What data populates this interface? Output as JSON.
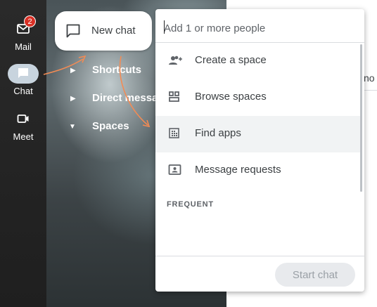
{
  "rail": {
    "items": [
      {
        "label": "Mail",
        "icon": "mail-icon",
        "badge": "2"
      },
      {
        "label": "Chat",
        "icon": "chat-icon"
      },
      {
        "label": "Meet",
        "icon": "video-icon"
      }
    ]
  },
  "nav": {
    "shortcuts": "Shortcuts",
    "direct_messages": "Direct messages",
    "spaces": "Spaces"
  },
  "new_chat": {
    "label": "New chat"
  },
  "dropdown": {
    "search_placeholder": "Add 1 or more people",
    "items": [
      {
        "label": "Create a space",
        "icon": "add-people-icon"
      },
      {
        "label": "Browse spaces",
        "icon": "browse-icon"
      },
      {
        "label": "Find apps",
        "icon": "apps-grid-icon"
      },
      {
        "label": "Message requests",
        "icon": "message-request-icon"
      }
    ],
    "section_header": "FREQUENT",
    "start_chat": "Start chat"
  },
  "right_page": {
    "partial_text": "no"
  },
  "colors": {
    "badge": "#d93025",
    "annotation_arrow": "#f28b54",
    "hover_row": "#f1f3f4",
    "disabled_button": "#e8eaed"
  }
}
